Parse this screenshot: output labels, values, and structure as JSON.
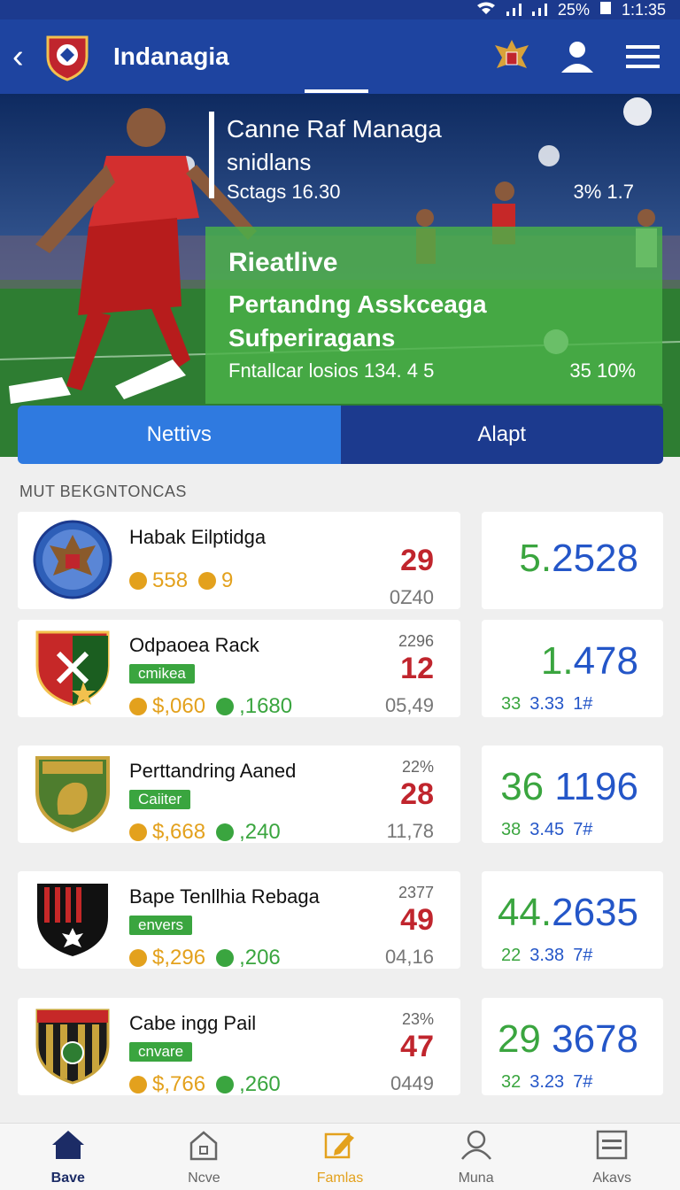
{
  "status": {
    "battery": "25%",
    "time": "1:1:35"
  },
  "appbar": {
    "title": "Indanagia"
  },
  "hero": {
    "heading": "Canne Raf Managa",
    "subheading": "snidlans",
    "stat_left": "Sctags 16.30",
    "stat_right": "3% 1.7",
    "panel_title": "Rieatlive",
    "panel_line1": "Pertandng Asskceaga",
    "panel_line2": "Sufperiragans",
    "panel_stat_left": "Fntallcar losios 134. 4 5",
    "panel_stat_right": "35 10%"
  },
  "toggle": {
    "left": "Nettivs",
    "right": "Alapt"
  },
  "section": {
    "title": "MUT BEKGNTONCAS"
  },
  "teams": [
    {
      "name": "Habak Eilptidga",
      "tag": "",
      "money": "558",
      "second": "9",
      "second_color": "gold",
      "pct": "",
      "big": "29",
      "small": "0Z40",
      "stat_a": "5.",
      "stat_b": "2528",
      "sub1": "",
      "sub2": "",
      "sub3": ""
    },
    {
      "name": "Odpaoea Rack",
      "tag": "cmikea",
      "money": "$,060",
      "second": ",1680",
      "second_color": "green",
      "pct": "2296",
      "big": "12",
      "small": "05,49",
      "stat_a": "1.",
      "stat_b": "478",
      "sub1": "33",
      "sub2": "3.33",
      "sub3": "1#"
    },
    {
      "name": "Perttandring Aaned",
      "tag": "Caiiter",
      "money": "$,668",
      "second": ",240",
      "second_color": "green",
      "pct": "22%",
      "big": "28",
      "small": "11,78",
      "stat_a": "36 ",
      "stat_b": "1196",
      "sub1": "38",
      "sub2": "3.45",
      "sub3": "7#"
    },
    {
      "name": "Bape Tenllhia Rebaga",
      "tag": "envers",
      "money": "$,296",
      "second": ",206",
      "second_color": "green",
      "pct": "2377",
      "big": "49",
      "small": "04,16",
      "stat_a": "44.",
      "stat_b": "2635",
      "sub1": "22",
      "sub2": "3.38",
      "sub3": "7#"
    },
    {
      "name": "Cabe ingg Pail",
      "tag": "cnvare",
      "money": "$,766",
      "second": ",260",
      "second_color": "green",
      "pct": "23%",
      "big": "47",
      "small": "0449",
      "stat_a": "29 ",
      "stat_b": "3678",
      "sub1": "32",
      "sub2": "3.23",
      "sub3": "7#"
    }
  ],
  "nav": [
    {
      "label": "Bave",
      "icon": "home-icon"
    },
    {
      "label": "Ncve",
      "icon": "building-icon"
    },
    {
      "label": "Famlas",
      "icon": "edit-icon"
    },
    {
      "label": "Muna",
      "icon": "person-icon"
    },
    {
      "label": "Akavs",
      "icon": "list-icon"
    }
  ],
  "colors": {
    "primary": "#1e44a0",
    "accent_green": "#3aa53f",
    "accent_red": "#c0252d",
    "gold": "#e3a11d"
  }
}
